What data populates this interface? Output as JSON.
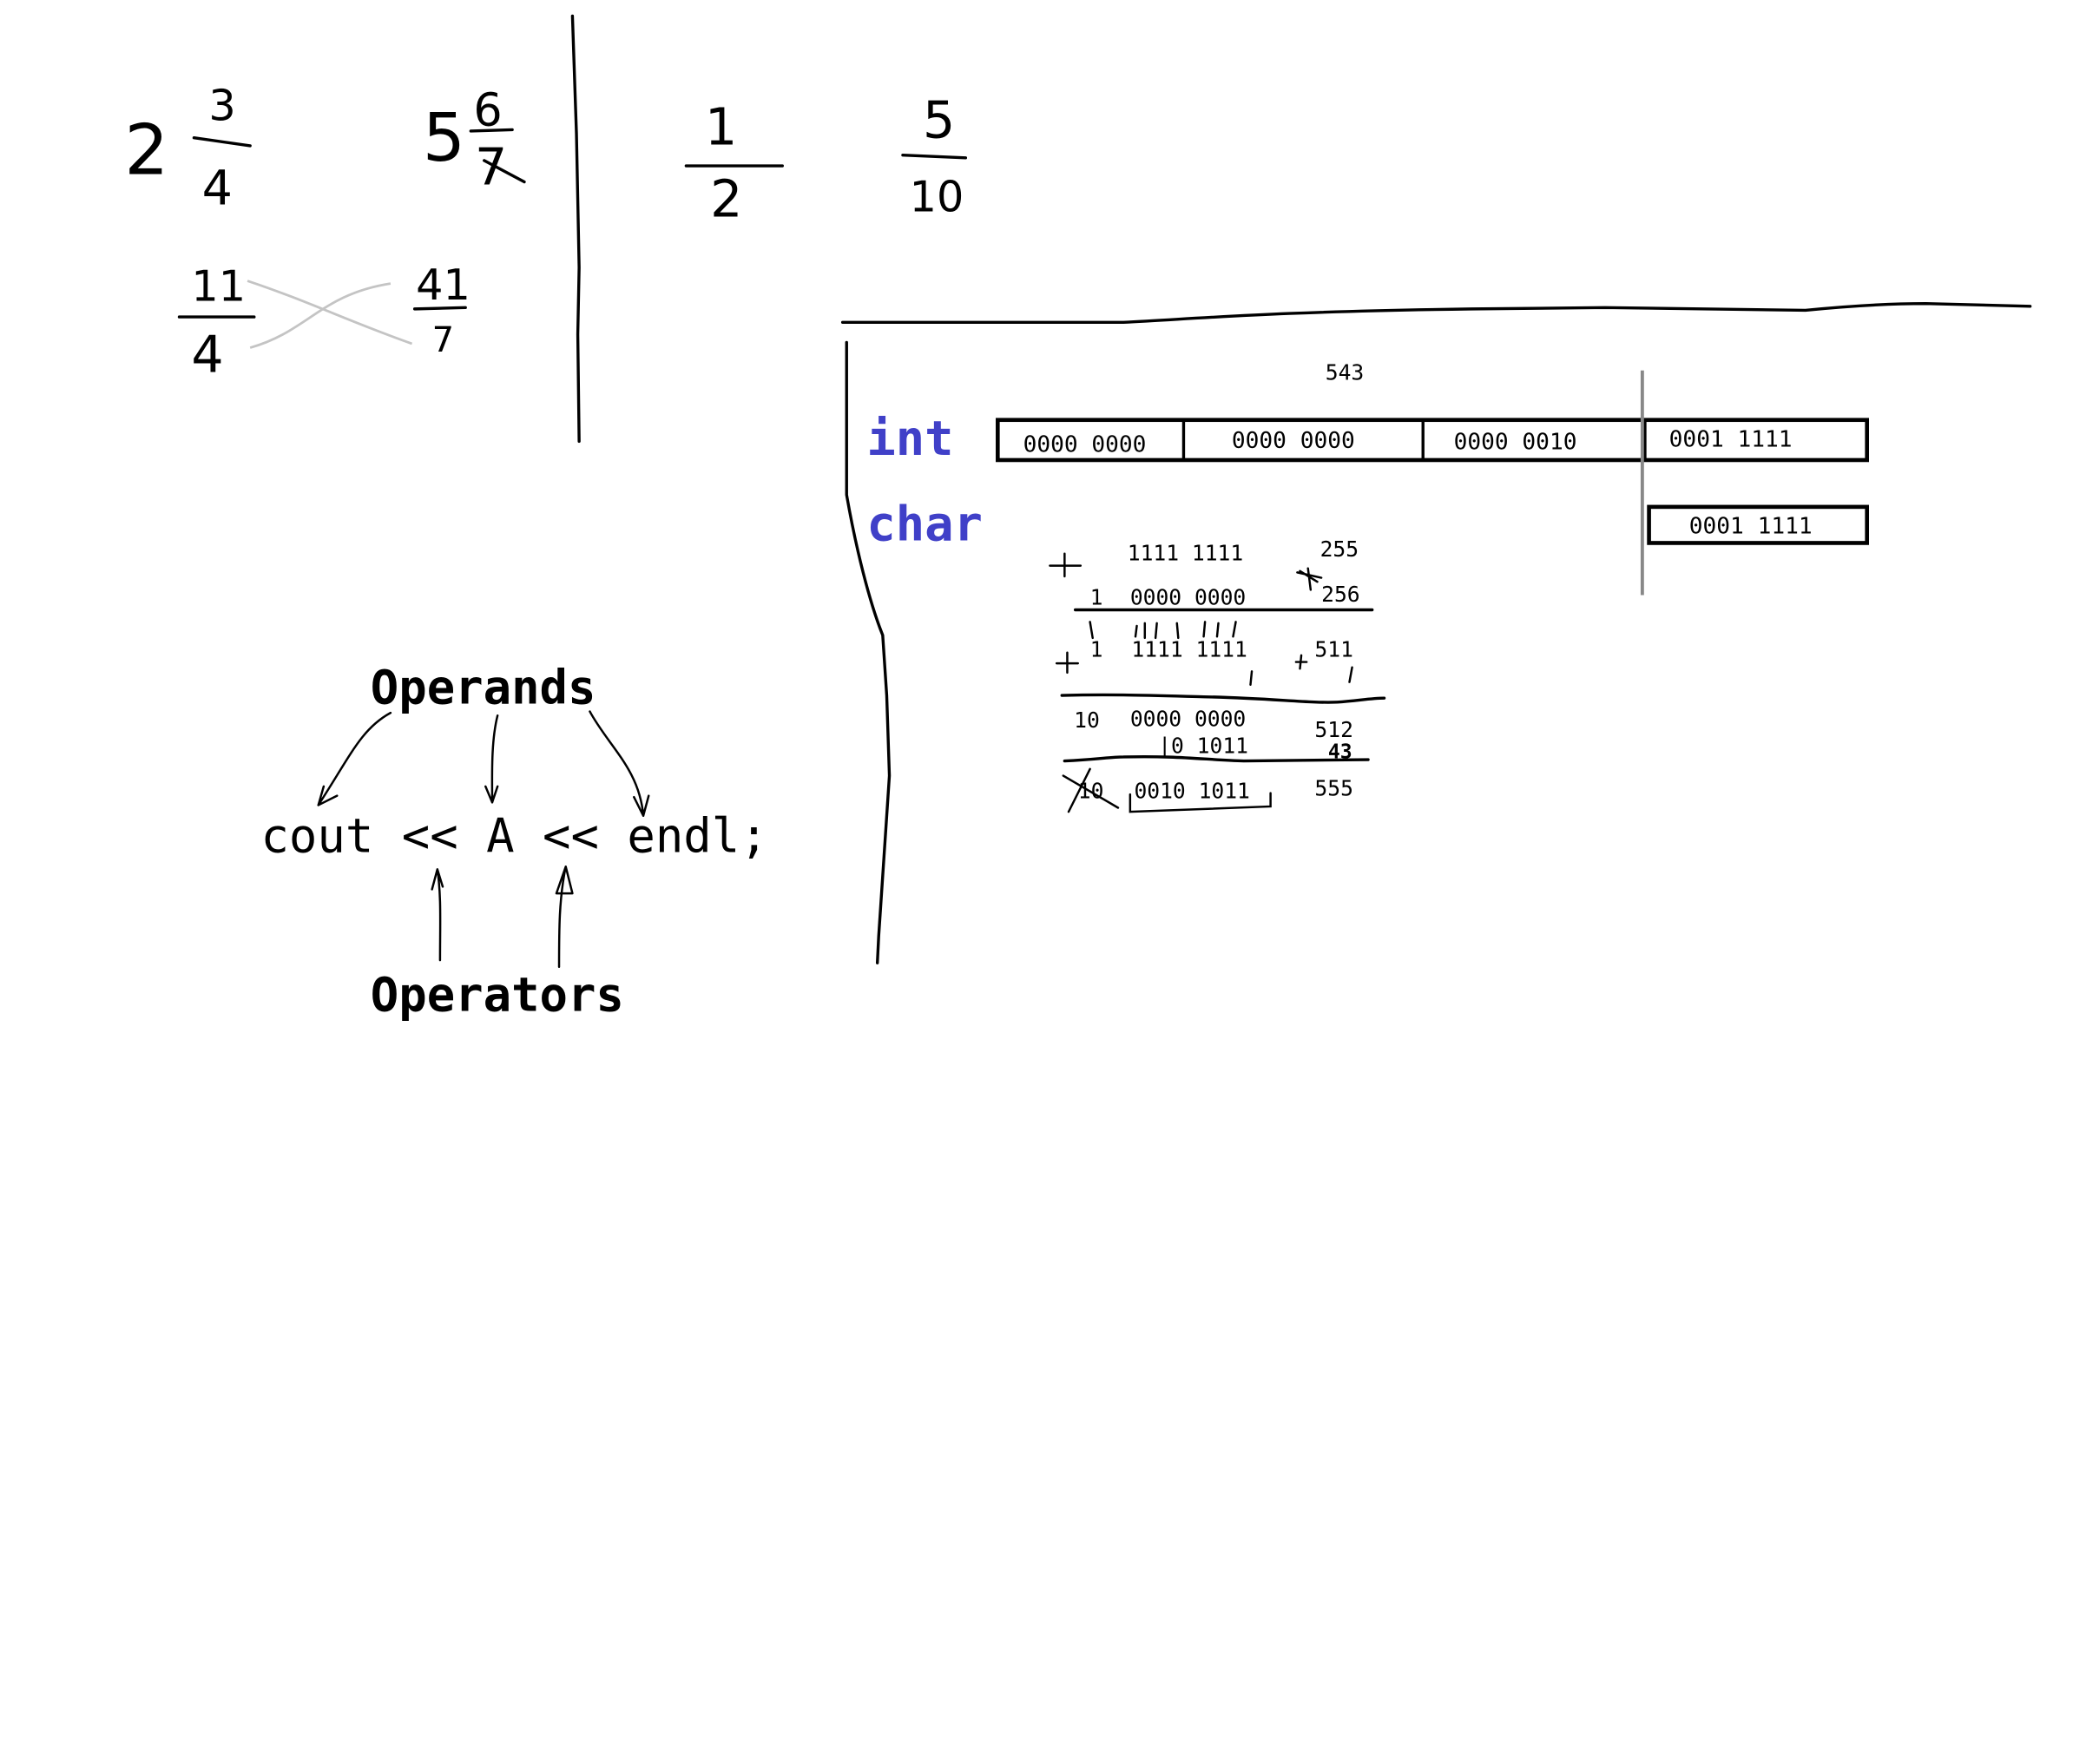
{
  "colors": {
    "keyword": "#4040c8",
    "ink": "#000000",
    "guide": "#888888",
    "cross": "#c4c4c4"
  },
  "fractions": {
    "mixed1": {
      "whole": "2",
      "num": "3",
      "den": "4"
    },
    "mixed2": {
      "whole": "5",
      "num": "6",
      "den": "7"
    },
    "improper1": {
      "num": "11",
      "den": "4"
    },
    "improper2": {
      "num": "41",
      "den": "7"
    },
    "half": {
      "num": "1",
      "den": "2"
    },
    "tenths": {
      "num": "5",
      "den": "10"
    }
  },
  "code": {
    "operands_label": "Operands",
    "statement": "cout << A << endl;",
    "operators_label": "Operators"
  },
  "memory": {
    "int_label": "int",
    "char_label": "char",
    "value_label": "543",
    "int_bytes": [
      "0000 0000",
      "0000 0000",
      "0000 0010",
      "0001 1111"
    ],
    "char_byte": "0001 1111"
  },
  "arithmetic": {
    "row1_bits": "1111 1111",
    "row1_dec": "255",
    "row2_carry": "1",
    "row2_bits": "0000 0000",
    "row2_dec": "256",
    "row3_carry": "1",
    "row3_bits": "1111 1111",
    "row3_dec": "511",
    "row4_carry": "10",
    "row4_bits": "0000 0000",
    "row4_dec": "512",
    "row5_bits": "|0 1011",
    "row5_dec": "43",
    "result_carry": "10",
    "result_bits": "0010 1011",
    "result_dec": "555"
  }
}
